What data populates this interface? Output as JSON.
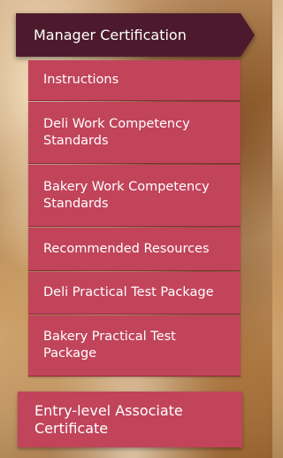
{
  "menu": {
    "header": "Manager Certification",
    "items": [
      "Instructions",
      "Deli Work Competency Standards",
      "Bakery Work Competency Standards",
      "Recommended Resources",
      "Deli Practical Test Package",
      "Bakery Practical Test Package"
    ],
    "footer": "Entry-level Associate Certificate"
  },
  "colors": {
    "header_bg": "#4c1a2c",
    "item_bg": "#c1445b",
    "text": "#ffffff"
  }
}
